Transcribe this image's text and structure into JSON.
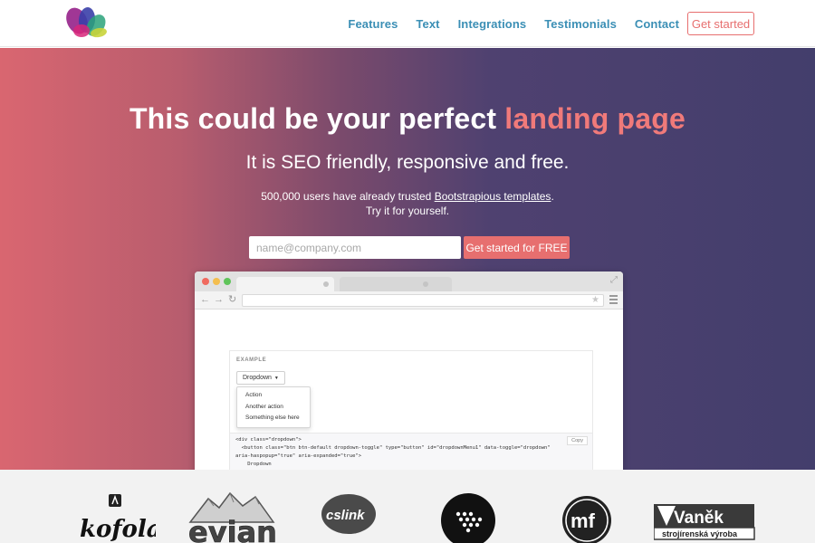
{
  "nav": {
    "links": [
      "Features",
      "Text",
      "Integrations",
      "Testimonials",
      "Contact"
    ],
    "cta": "Get started"
  },
  "hero": {
    "title_main": "This could be your perfect ",
    "title_accent": "landing page",
    "subtitle": "It is SEO friendly, responsive and free.",
    "info_prefix": "500,000 users have already trusted ",
    "info_link": "Bootstrapious templates",
    "info_suffix": ".",
    "info_line2": "Try it for yourself.",
    "email_placeholder": "name@company.com",
    "signup_button": "Get started for FREE"
  },
  "mockup": {
    "example_label": "EXAMPLE",
    "dropdown_label": "Dropdown",
    "dropdown_items": [
      "Action",
      "Another action",
      "Something else here"
    ],
    "copy_label": "Copy",
    "code_lines": [
      "<div class=\"dropdown\">",
      "  <button class=\"btn btn-default dropdown-toggle\" type=\"button\" id=\"dropdownMenu1\" data-toggle=\"dropdown\"",
      "aria-haspopup=\"true\" aria-expanded=\"true\">",
      "    Dropdown"
    ]
  },
  "clients": {
    "kofola": "kofola",
    "evian": "evian",
    "cslink": "cslink",
    "mf": "mf",
    "vanek": "Vaněk",
    "vanek_sub": "strojírenská výroba"
  },
  "colors": {
    "accent": "#e76f6f",
    "nav_link": "#3b8fb5",
    "hero_left": "#d96670",
    "hero_right": "#433e6c"
  }
}
